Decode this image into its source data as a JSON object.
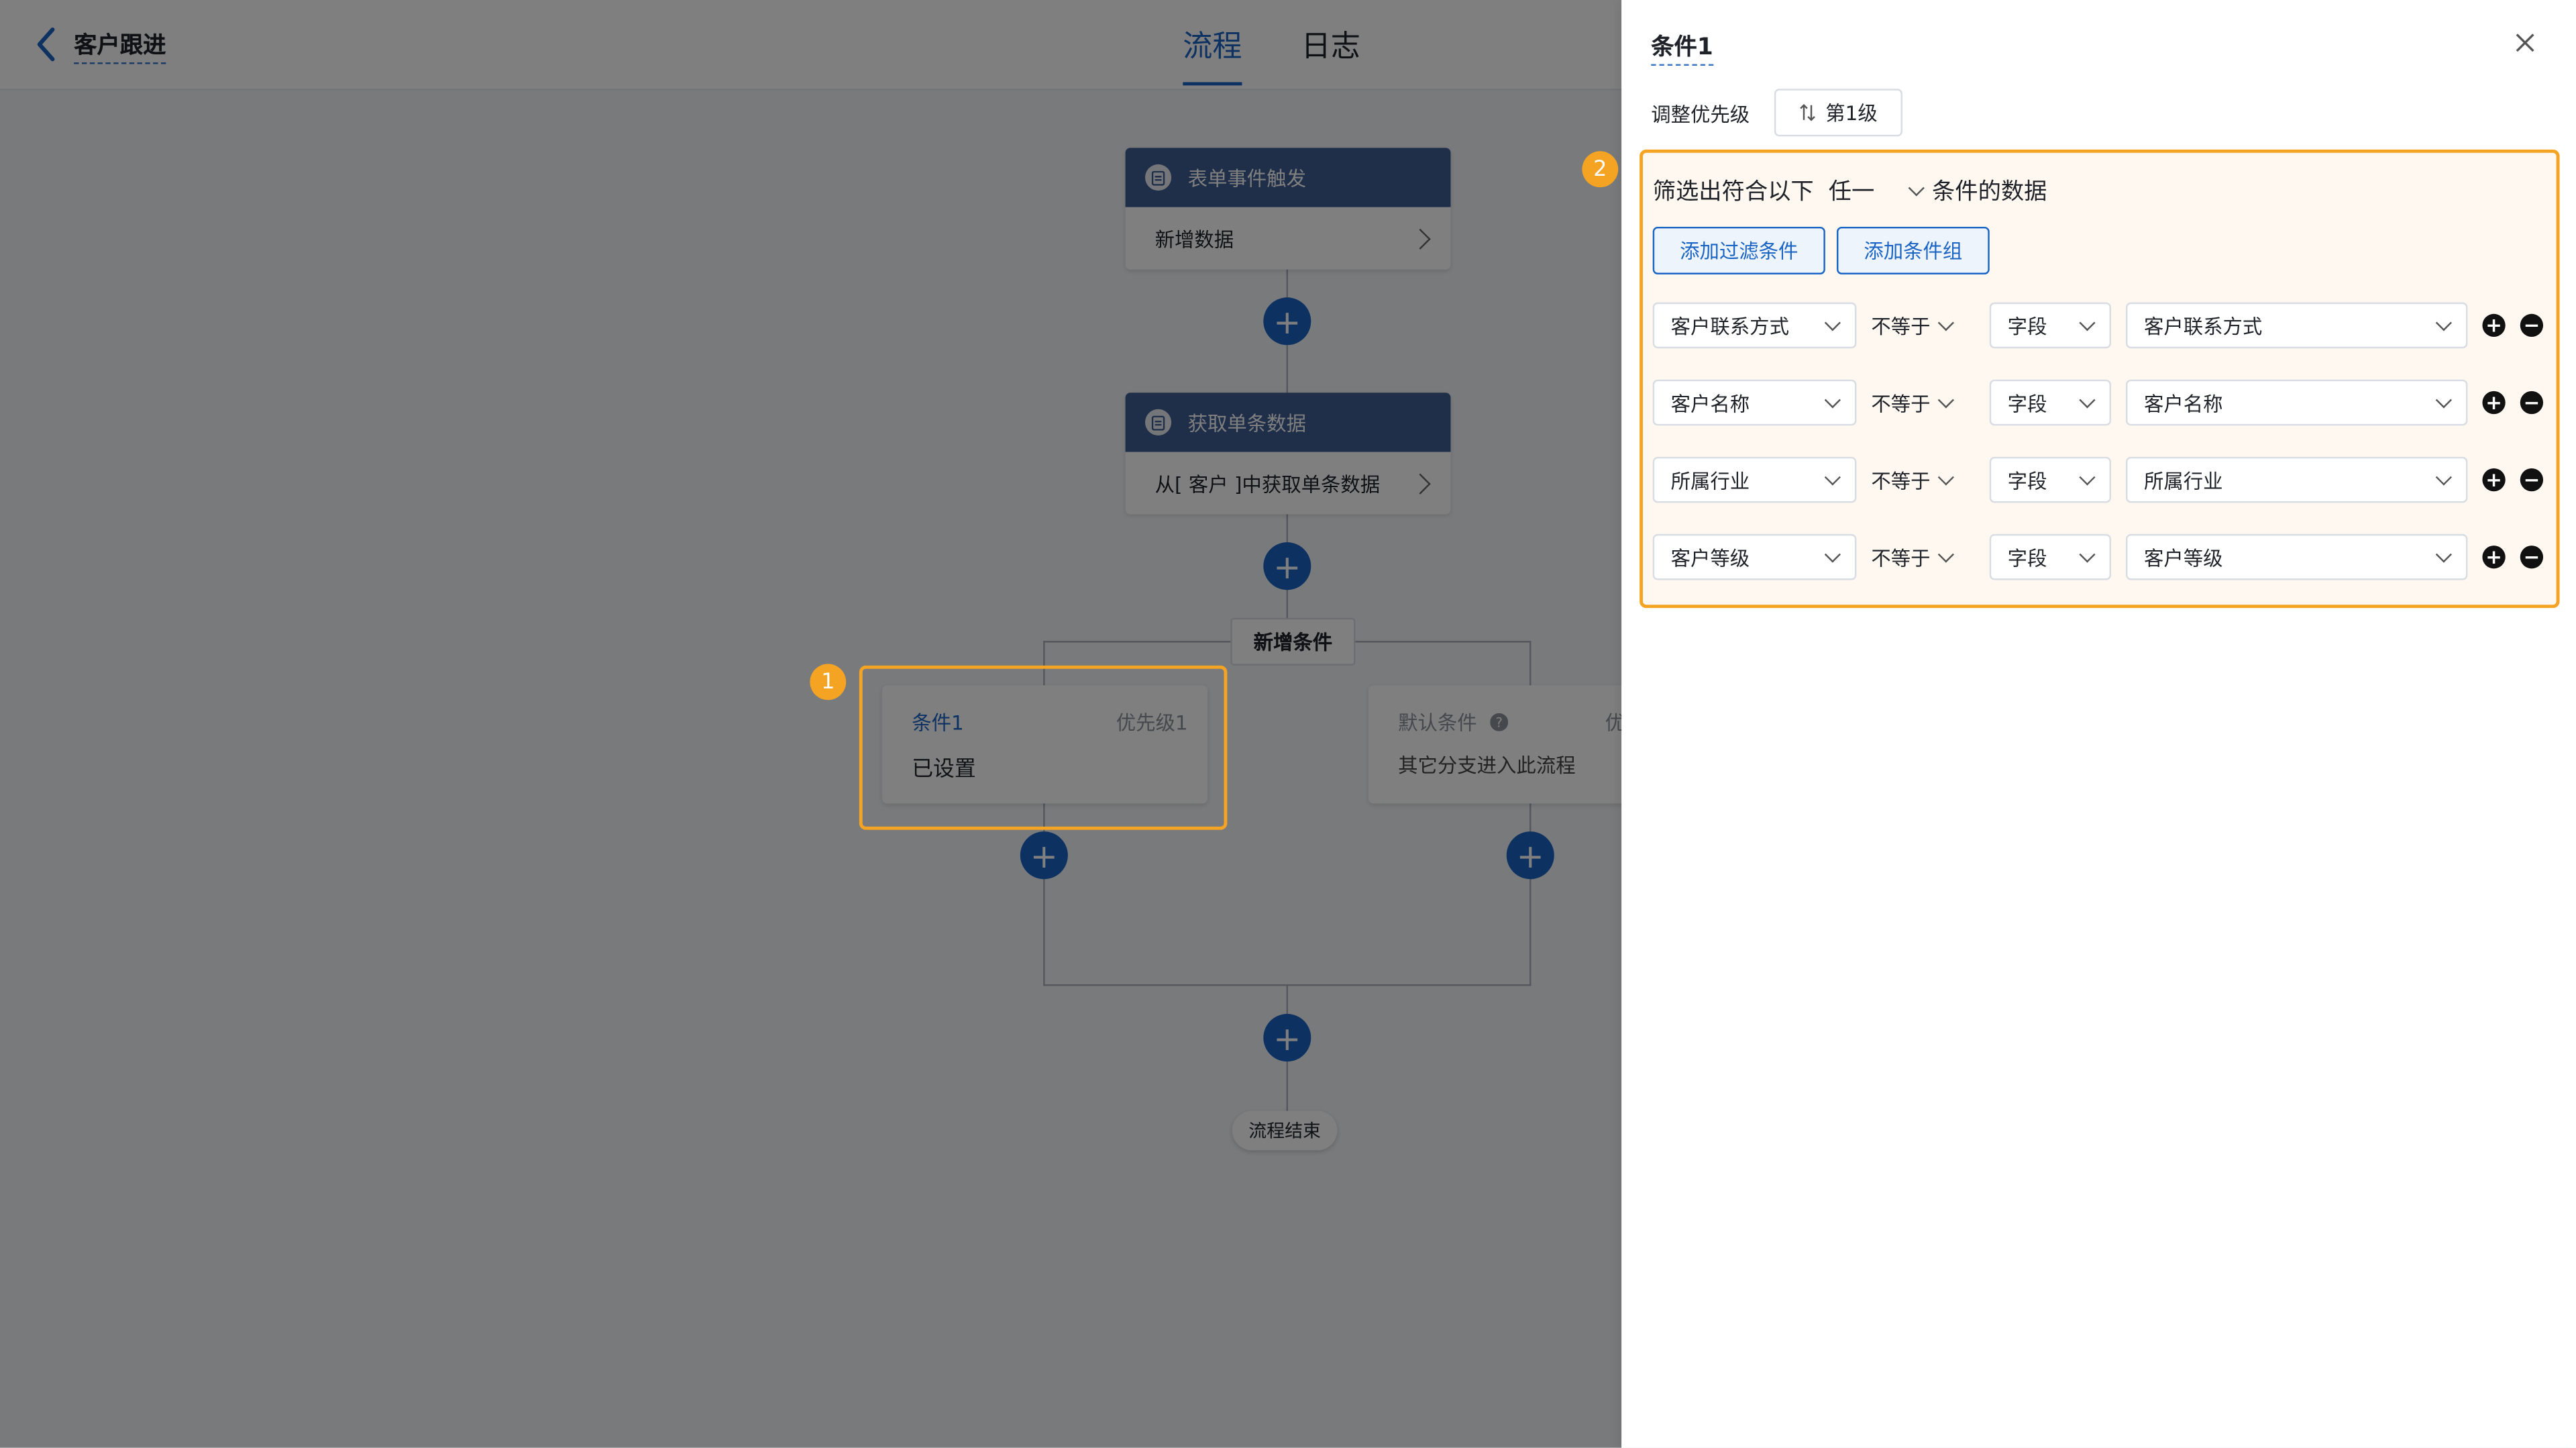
{
  "header": {
    "title": "客户跟进",
    "tabs": [
      {
        "label": "流程",
        "active": true
      },
      {
        "label": "日志",
        "active": false
      }
    ]
  },
  "flow": {
    "trigger_node": {
      "title": "表单事件触发",
      "body": "新增数据"
    },
    "fetch_node": {
      "title": "获取单条数据",
      "body": "从[ 客户 ]中获取单条数据"
    },
    "add_condition_label": "新增条件",
    "branches": [
      {
        "name": "条件1",
        "priority": "优先级1",
        "status": "已设置"
      },
      {
        "name": "默认条件",
        "priority": "优",
        "status": "其它分支进入此流程"
      }
    ],
    "end_label": "流程结束"
  },
  "badges": {
    "one": "1",
    "two": "2"
  },
  "drawer": {
    "title": "条件1",
    "priority_label": "调整优先级",
    "priority_value": "第1级",
    "filter_prefix": "筛选出符合以下",
    "filter_mode": "任一",
    "filter_suffix": "条件的数据",
    "add_filter_label": "添加过滤条件",
    "add_group_label": "添加条件组",
    "conditions": [
      {
        "field": "客户联系方式",
        "operator": "不等于",
        "value_type": "字段",
        "value": "客户联系方式"
      },
      {
        "field": "客户名称",
        "operator": "不等于",
        "value_type": "字段",
        "value": "客户名称"
      },
      {
        "field": "所属行业",
        "operator": "不等于",
        "value_type": "字段",
        "value": "所属行业"
      },
      {
        "field": "客户等级",
        "operator": "不等于",
        "value_type": "字段",
        "value": "客户等级"
      }
    ],
    "add_symbol": "+",
    "remove_symbol": "−"
  },
  "colors": {
    "accent": "#1a64c4",
    "highlight": "#f5a323",
    "node_header": "#3f5c92"
  }
}
